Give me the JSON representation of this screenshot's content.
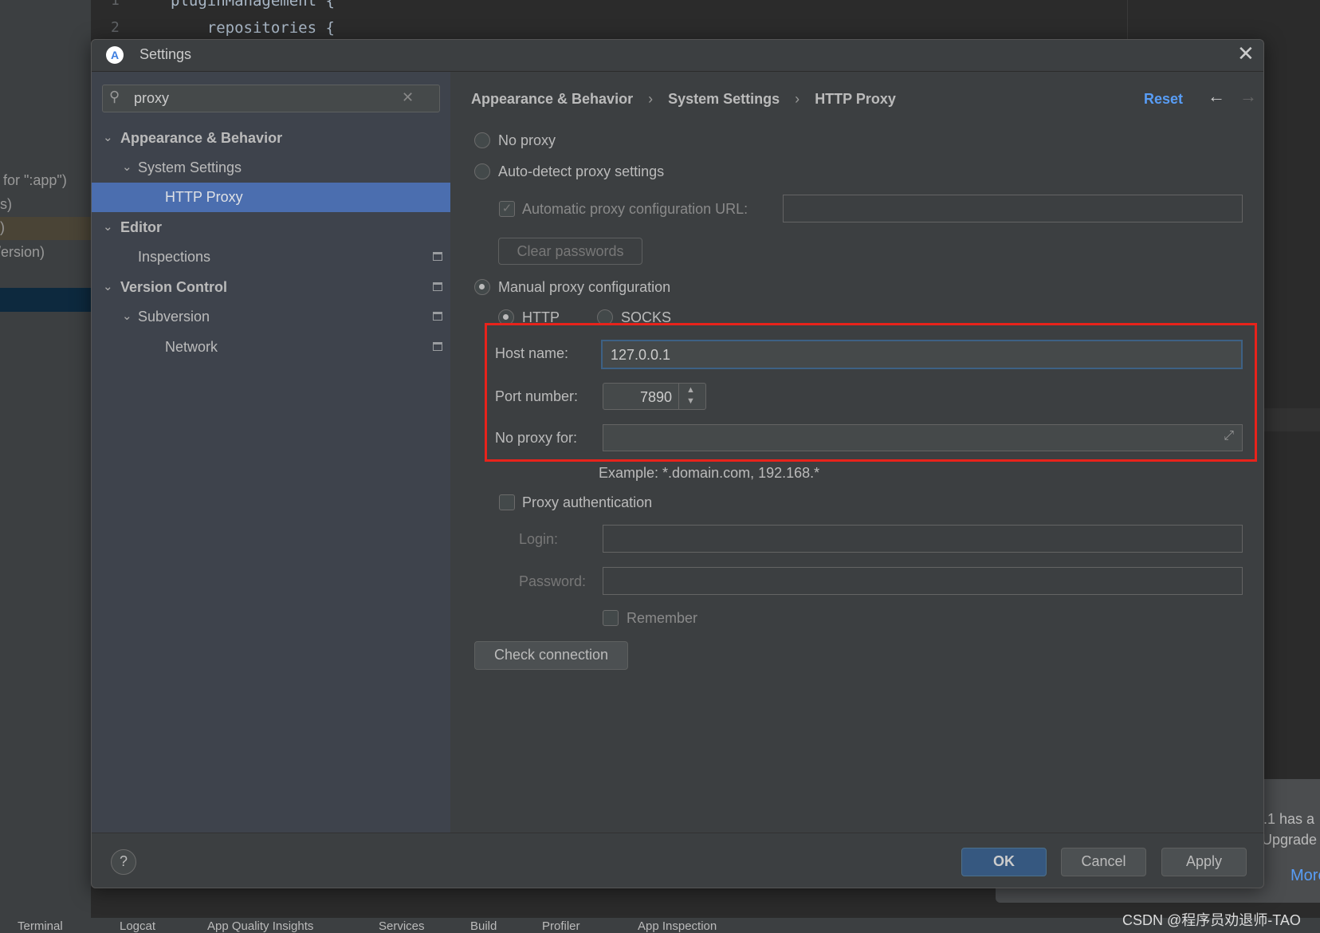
{
  "background": {
    "code_lines": [
      {
        "num": "1",
        "text": "pluginManagement {"
      },
      {
        "num": "2",
        "text": "    repositories {"
      }
    ],
    "left_fragments": [
      "for \":app\")",
      "s)",
      ")",
      "/ersion)"
    ],
    "notification": {
      "line1": ".1 has a",
      "line2": "Upgrade",
      "link": "More"
    },
    "toolwindows": [
      "Terminal",
      "Logcat",
      "App Quality Insights",
      "Services",
      "Build",
      "Profiler",
      "App Inspection"
    ],
    "watermark": "CSDN @程序员劝退师-TAO"
  },
  "dialog": {
    "title": "Settings",
    "search": {
      "value": "proxy"
    },
    "tree": [
      {
        "label": "Appearance & Behavior",
        "level": 0,
        "bold": true,
        "expanded": true
      },
      {
        "label": "System Settings",
        "level": 1,
        "expanded": true
      },
      {
        "label": "HTTP Proxy",
        "level": 2,
        "selected": true
      },
      {
        "label": "Editor",
        "level": 0,
        "bold": true,
        "expanded": true
      },
      {
        "label": "Inspections",
        "level": 1,
        "badge": true
      },
      {
        "label": "Version Control",
        "level": 0,
        "bold": true,
        "expanded": true,
        "badge": true
      },
      {
        "label": "Subversion",
        "level": 1,
        "expanded": true,
        "badge": true
      },
      {
        "label": "Network",
        "level": 2,
        "badge": true
      }
    ],
    "breadcrumb": [
      "Appearance & Behavior",
      "System Settings",
      "HTTP Proxy"
    ],
    "reset_label": "Reset",
    "accent": "#589df6",
    "form": {
      "no_proxy": "No proxy",
      "auto_detect": "Auto-detect proxy settings",
      "auto_url_label": "Automatic proxy configuration URL:",
      "auto_url_checked": true,
      "auto_url_value": "",
      "clear_passwords": "Clear passwords",
      "manual": "Manual proxy configuration",
      "selected_mode": "manual",
      "http": "HTTP",
      "socks": "SOCKS",
      "selected_protocol": "HTTP",
      "host_label": "Host name:",
      "host_value": "127.0.0.1",
      "port_label": "Port number:",
      "port_value": "7890",
      "no_proxy_for_label": "No proxy for:",
      "no_proxy_for_value": "",
      "example": "Example: *.domain.com, 192.168.*",
      "proxy_auth": "Proxy authentication",
      "proxy_auth_checked": false,
      "login_label": "Login:",
      "password_label": "Password:",
      "remember": "Remember",
      "check_connection": "Check connection"
    },
    "footer": {
      "help": "?",
      "ok": "OK",
      "cancel": "Cancel",
      "apply": "Apply"
    }
  }
}
